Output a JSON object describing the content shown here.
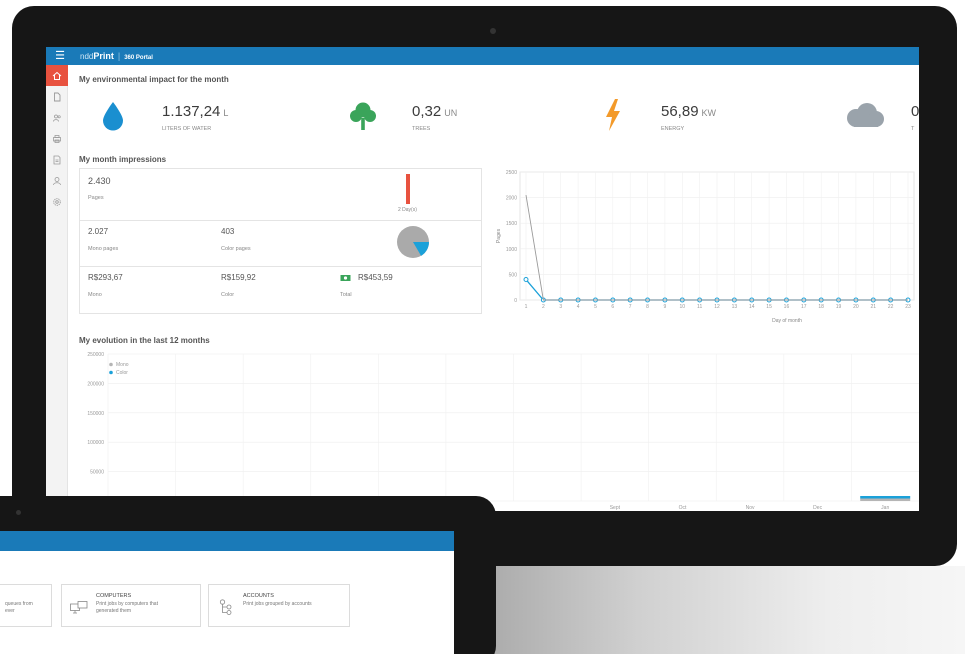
{
  "topbar": {
    "brand_prefix": "nddPrint",
    "brand_prefix_thin": "ndd",
    "brand_prefix_bold": "Print",
    "separator": "|",
    "portal_label": "360 Portal"
  },
  "sidebar": {
    "items": [
      {
        "icon": "home-icon",
        "active": true
      },
      {
        "icon": "document-icon",
        "active": false
      },
      {
        "icon": "users-icon",
        "active": false
      },
      {
        "icon": "printer-icon",
        "active": false
      },
      {
        "icon": "report-icon",
        "active": false
      },
      {
        "icon": "user-icon",
        "active": false
      },
      {
        "icon": "settings-icon",
        "active": false
      }
    ]
  },
  "environment": {
    "title": "My environmental impact for the month",
    "metrics": [
      {
        "icon": "water-drop-icon",
        "value": "1.137,24",
        "unit": "L",
        "label": "LITERS OF WATER",
        "color": "#1a8fd0"
      },
      {
        "icon": "tree-icon",
        "value": "0,32",
        "unit": "UN",
        "label": "TREES",
        "color": "#3aa45a"
      },
      {
        "icon": "lightning-icon",
        "value": "56,89",
        "unit": "KW",
        "label": "ENERGY",
        "color": "#f39a2a"
      },
      {
        "icon": "cloud-icon",
        "value": "0",
        "unit": "",
        "label": "T",
        "color": "#9aa3ab"
      }
    ]
  },
  "impressions": {
    "title": "My month impressions",
    "pages_value": "2.430",
    "pages_label": "Pages",
    "days_label": "2 Day(s)",
    "mono_pages_value": "2.027",
    "mono_pages_label": "Mono pages",
    "color_pages_value": "403",
    "color_pages_label": "Color pages",
    "mono_cost_value": "R$293,67",
    "mono_cost_label": "Mono",
    "color_cost_value": "R$159,92",
    "color_cost_label": "Color",
    "total_cost_value": "R$453,59",
    "total_cost_label": "Total",
    "color_share": 0.166
  },
  "chart_data": [
    {
      "type": "line",
      "xlabel": "Day of month",
      "ylabel": "Pages",
      "ylim": [
        0,
        2500
      ],
      "yticks": [
        "2500",
        "2000",
        "1500",
        "1000",
        "500",
        "0"
      ],
      "x": [
        "1",
        "2",
        "3",
        "4",
        "5",
        "6",
        "7",
        "8",
        "9",
        "10",
        "11",
        "12",
        "13",
        "14",
        "15",
        "16",
        "17",
        "18",
        "19",
        "20",
        "21",
        "22",
        "23"
      ],
      "series": [
        {
          "values": [
            400,
            0,
            0,
            0,
            0,
            0,
            0,
            0,
            0,
            0,
            0,
            0,
            0,
            0,
            0,
            0,
            0,
            0,
            0,
            0,
            0,
            0,
            0
          ],
          "color": "#1ba1d9"
        },
        {
          "values": [
            2050,
            0,
            0,
            0,
            0,
            0,
            0,
            0,
            0,
            0,
            0,
            0,
            0,
            0,
            0,
            0,
            0,
            0,
            0,
            0,
            0,
            0,
            0
          ],
          "color": "#9a9a9a"
        }
      ],
      "grid": true
    },
    {
      "type": "bar",
      "title": "My evolution in the last 12 months",
      "ylim": [
        0,
        250000
      ],
      "yticks": [
        "250000",
        "200000",
        "150000",
        "100000",
        "50000",
        "0"
      ],
      "categories": [
        "",
        "",
        "",
        "",
        "",
        "",
        "",
        "Sept",
        "Oct",
        "Nov",
        "Dec",
        "Jan"
      ],
      "series": [
        {
          "name": "Mono",
          "color": "#b5b5b5",
          "values": [
            0,
            0,
            0,
            0,
            0,
            0,
            0,
            0,
            0,
            0,
            0,
            2027
          ]
        },
        {
          "name": "Color",
          "color": "#1ba1d9",
          "values": [
            0,
            0,
            0,
            0,
            0,
            0,
            0,
            0,
            0,
            0,
            0,
            403
          ]
        }
      ],
      "legend": "top-left",
      "grid": true
    }
  ],
  "tablet": {
    "cards": [
      {
        "icon": "queue-icon",
        "title": "",
        "desc_line1": "queues from",
        "desc_line2": "ever"
      },
      {
        "icon": "computer-icon",
        "title": "COMPUTERS",
        "desc_line1": "Print jobs by computers that",
        "desc_line2": "generated them"
      },
      {
        "icon": "accounts-icon",
        "title": "ACCOUNTS",
        "desc_line1": "Print jobs grouped by accounts",
        "desc_line2": ""
      }
    ]
  }
}
